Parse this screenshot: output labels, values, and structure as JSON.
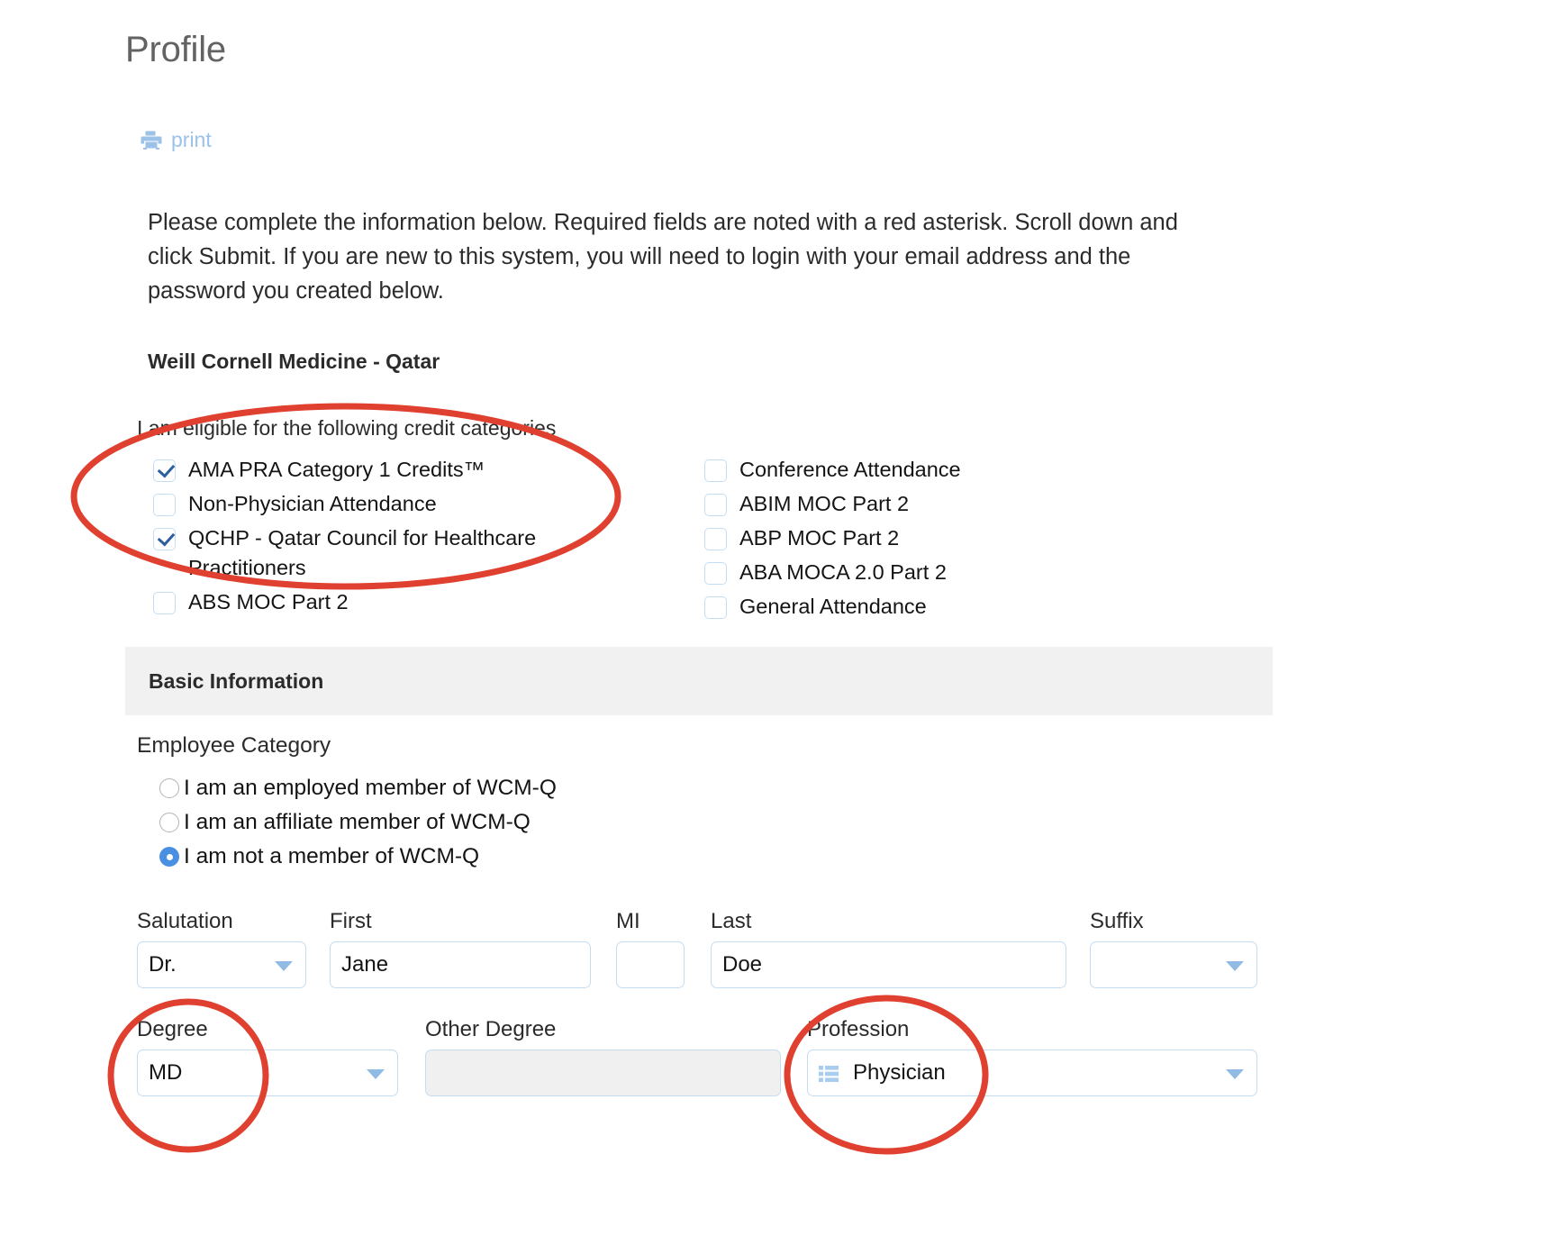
{
  "header": {
    "title": "Profile"
  },
  "print": {
    "icon": "printer-icon",
    "label": "print"
  },
  "instructions": {
    "text": "Please complete the information below. Required fields are noted with a red asterisk. Scroll down and click Submit. If you are new to this system, you will need to login with your email address and the password you created below."
  },
  "organization": {
    "name": "Weill Cornell Medicine - Qatar"
  },
  "credit_categories": {
    "label": "I am eligible for the following credit categories",
    "left_column": [
      {
        "label": "AMA PRA Category 1 Credits™",
        "checked": true
      },
      {
        "label": "Non-Physician Attendance",
        "checked": false
      },
      {
        "label": "QCHP - Qatar Council for Healthcare Practitioners",
        "checked": true
      },
      {
        "label": "ABS MOC Part 2",
        "checked": false
      }
    ],
    "right_column": [
      {
        "label": "Conference Attendance",
        "checked": false
      },
      {
        "label": "ABIM MOC Part 2",
        "checked": false
      },
      {
        "label": "ABP MOC Part 2",
        "checked": false
      },
      {
        "label": "ABA MOCA 2.0 Part 2",
        "checked": false
      },
      {
        "label": "General Attendance",
        "checked": false
      }
    ]
  },
  "basic_information": {
    "section_title": "Basic Information",
    "employee_category": {
      "label": "Employee Category",
      "options": [
        {
          "label": "I am an employed member of WCM-Q",
          "selected": false
        },
        {
          "label": "I am an affiliate member of WCM-Q",
          "selected": false
        },
        {
          "label": "I am not a member of WCM-Q",
          "selected": true
        }
      ]
    },
    "name_fields": {
      "salutation": {
        "label": "Salutation",
        "value": "Dr.",
        "type": "select"
      },
      "first": {
        "label": "First",
        "value": "Jane",
        "placeholder": "",
        "type": "text"
      },
      "mi": {
        "label": "MI",
        "value": "",
        "placeholder": "",
        "type": "text"
      },
      "last": {
        "label": "Last",
        "value": "Doe",
        "placeholder": "",
        "type": "text"
      },
      "suffix": {
        "label": "Suffix",
        "value": "",
        "type": "select"
      }
    },
    "degree_fields": {
      "degree": {
        "label": "Degree",
        "value": "MD",
        "type": "select"
      },
      "other_degree": {
        "label": "Other Degree",
        "value": "",
        "placeholder": "",
        "type": "text",
        "disabled": true
      },
      "profession": {
        "label": "Profession",
        "value": "Physician",
        "type": "select",
        "icon": "list-icon"
      }
    }
  },
  "annotations": {
    "color": "#e0402f",
    "shapes": [
      {
        "name": "credit-categories-highlight"
      },
      {
        "name": "degree-highlight"
      },
      {
        "name": "profession-highlight"
      }
    ]
  }
}
